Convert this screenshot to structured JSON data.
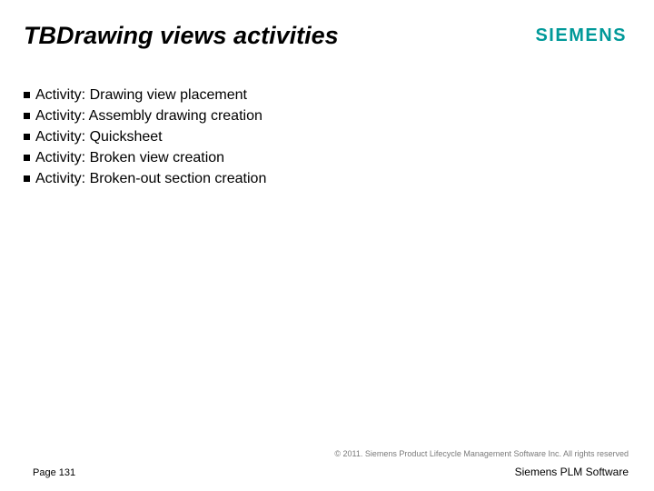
{
  "header": {
    "logo_text": "SIEMENS",
    "title": "TBDrawing views activities"
  },
  "bullets": [
    "Activity: Drawing view placement",
    "Activity: Assembly drawing creation",
    "Activity: Quicksheet",
    "Activity: Broken view creation",
    "Activity: Broken-out section creation"
  ],
  "footer": {
    "copyright": "© 2011. Siemens Product Lifecycle Management Software Inc. All rights reserved",
    "page": "Page 131",
    "brand": "Siemens PLM Software"
  }
}
